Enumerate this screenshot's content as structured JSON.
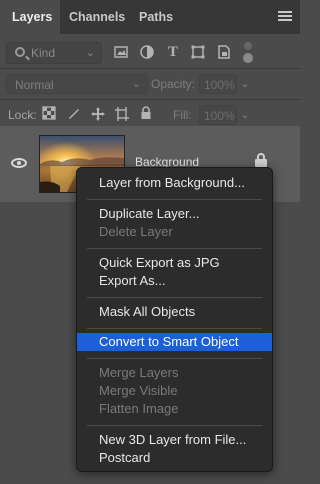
{
  "tabs": [
    {
      "label": "Layers",
      "active": true
    },
    {
      "label": "Channels",
      "active": false
    },
    {
      "label": "Paths",
      "active": false
    }
  ],
  "filter": {
    "kind_label": "Kind",
    "icons": [
      "pixel-layer-filter-icon",
      "adjustment-layer-filter-icon",
      "type-layer-filter-icon",
      "shape-layer-filter-icon",
      "smart-object-filter-icon",
      "filter-toggle-icon"
    ]
  },
  "blend": {
    "mode": "Normal",
    "opacity_label": "Opacity:",
    "opacity_value": "100%"
  },
  "lock": {
    "label": "Lock:",
    "fill_label": "Fill:",
    "fill_value": "100%"
  },
  "layer": {
    "name": "Background",
    "visible": true,
    "locked": true
  },
  "context_menu": {
    "groups": [
      [
        {
          "label": "Layer from Background...",
          "enabled": true
        }
      ],
      [
        {
          "label": "Duplicate Layer...",
          "enabled": true
        },
        {
          "label": "Delete Layer",
          "enabled": false
        }
      ],
      [
        {
          "label": "Quick Export as JPG",
          "enabled": true
        },
        {
          "label": "Export As...",
          "enabled": true
        }
      ],
      [
        {
          "label": "Mask All Objects",
          "enabled": true
        }
      ],
      [
        {
          "label": "Convert to Smart Object",
          "enabled": true,
          "highlighted": true
        }
      ],
      [
        {
          "label": "Merge Layers",
          "enabled": false
        },
        {
          "label": "Merge Visible",
          "enabled": false
        },
        {
          "label": "Flatten Image",
          "enabled": false
        }
      ],
      [
        {
          "label": "New 3D Layer from File...",
          "enabled": true
        },
        {
          "label": "Postcard",
          "enabled": true
        }
      ]
    ]
  },
  "colors": {
    "panel_bg": "#4b4b4b",
    "menu_bg": "#2c2c2c",
    "highlight": "#1c5fd6"
  }
}
